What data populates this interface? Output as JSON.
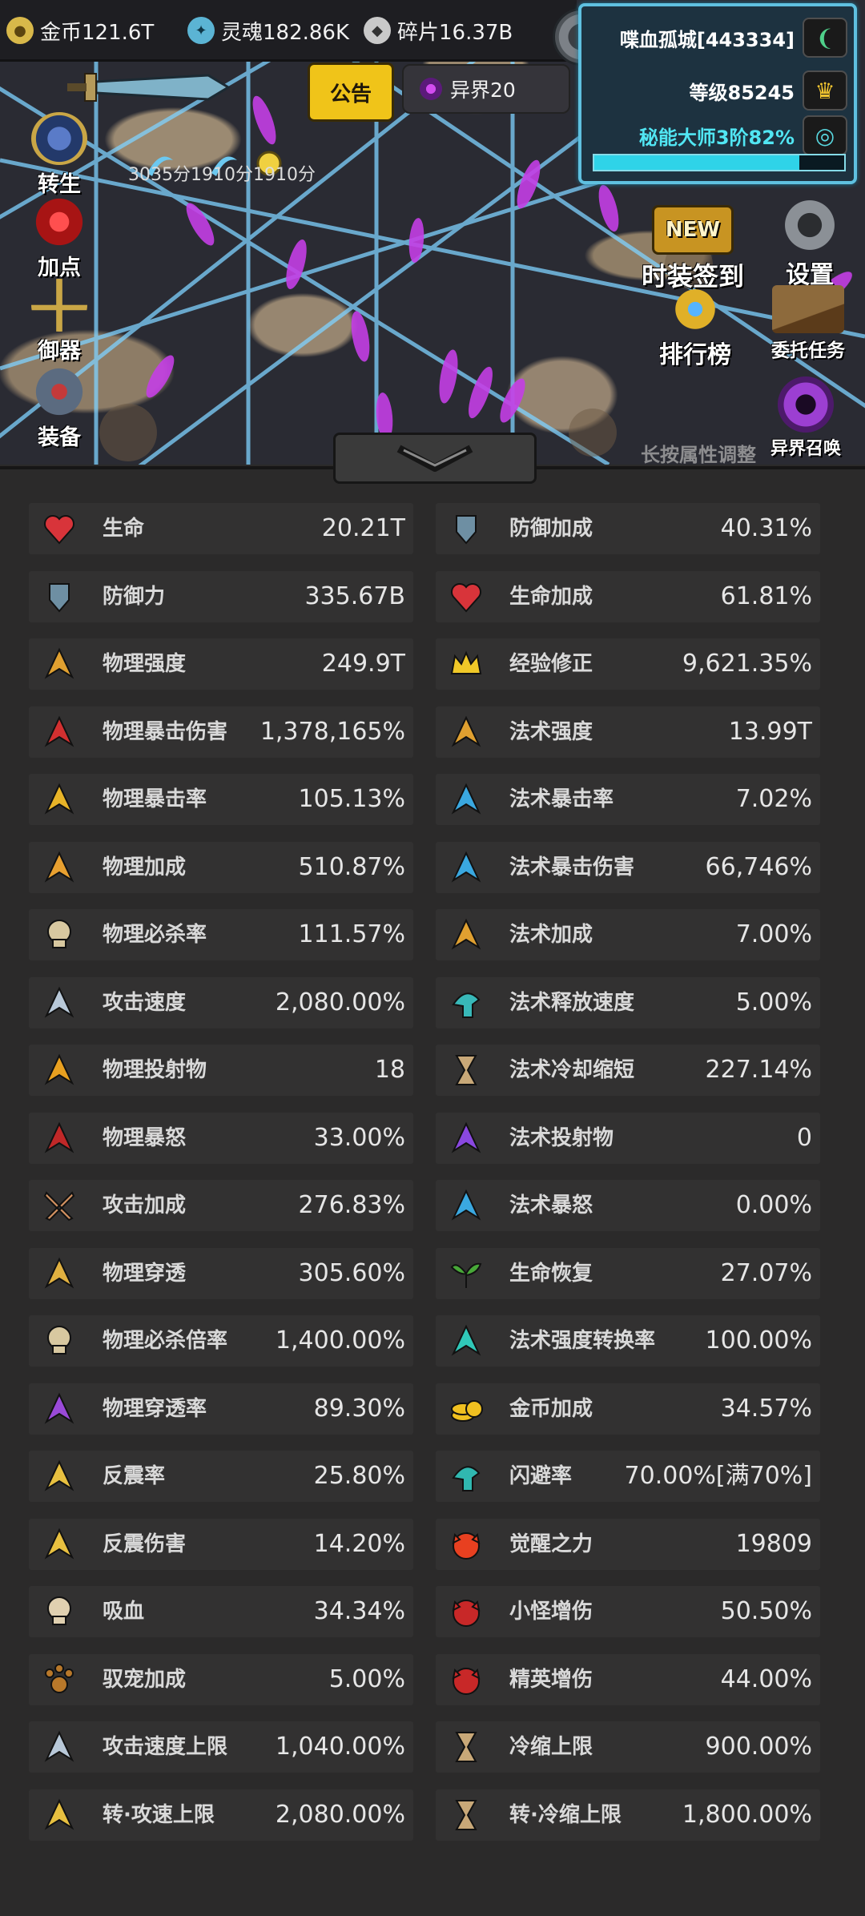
{
  "resources": [
    {
      "icon": "gold-coin-icon",
      "label": "金币121.6T"
    },
    {
      "icon": "soul-icon",
      "label": "灵魂182.86K"
    },
    {
      "icon": "shard-icon",
      "label": "碎片16.37B"
    }
  ],
  "player": {
    "name": "喋血孤城[443334]",
    "level": "等级85245",
    "rank": "秘能大师3阶82%",
    "rank_progress": 0.82
  },
  "top_buttons": {
    "notice": "公告",
    "realm": "异界20"
  },
  "buffs_text": "3035分1910分1910分",
  "left_menu": [
    "转生",
    "加点",
    "御器",
    "装备"
  ],
  "right_menu": {
    "new_badge": "NEW",
    "costume_signin": "时装签到",
    "settings": "设置",
    "ranking": "排行榜",
    "commission": "委托任务",
    "realm_summon": "异界召唤"
  },
  "hint": "长按属性调整",
  "stats_left": [
    {
      "label": "生命",
      "value": "20.21T",
      "icon": "heart-icon",
      "color": "#d8343a"
    },
    {
      "label": "防御力",
      "value": "335.67B",
      "icon": "shield-icon",
      "color": "#6e8fa3"
    },
    {
      "label": "物理强度",
      "value": "249.9T",
      "icon": "arrow-burst-icon",
      "color": "#e0a030"
    },
    {
      "label": "物理暴击伤害",
      "value": "1,378,165%",
      "icon": "crit-damage-icon",
      "color": "#d23030"
    },
    {
      "label": "物理暴击率",
      "value": "105.13%",
      "icon": "crit-rate-icon",
      "color": "#e8b428"
    },
    {
      "label": "物理加成",
      "value": "510.87%",
      "icon": "sword-bonus-icon",
      "color": "#e8a030"
    },
    {
      "label": "物理必杀率",
      "value": "111.57%",
      "icon": "skull-icon",
      "color": "#d8c8a0"
    },
    {
      "label": "攻击速度",
      "value": "2,080.00%",
      "icon": "attack-speed-icon",
      "color": "#b8c8d8"
    },
    {
      "label": "物理投射物",
      "value": "18",
      "icon": "projectile-icon",
      "color": "#e8a020"
    },
    {
      "label": "物理暴怒",
      "value": "33.00%",
      "icon": "rage-icon",
      "color": "#c02828"
    },
    {
      "label": "攻击加成",
      "value": "276.83%",
      "icon": "crossed-swords-icon",
      "color": "#d09060"
    },
    {
      "label": "物理穿透",
      "value": "305.60%",
      "icon": "penetration-icon",
      "color": "#e0b040"
    },
    {
      "label": "物理必杀倍率",
      "value": "1,400.00%",
      "icon": "skull-multiplier-icon",
      "color": "#d8c8a0"
    },
    {
      "label": "物理穿透率",
      "value": "89.30%",
      "icon": "penetration-rate-icon",
      "color": "#9a4ad8"
    },
    {
      "label": "反震率",
      "value": "25.80%",
      "icon": "reflect-icon",
      "color": "#e8c040"
    },
    {
      "label": "反震伤害",
      "value": "14.20%",
      "icon": "reflect-damage-icon",
      "color": "#e8c040"
    },
    {
      "label": "吸血",
      "value": "34.34%",
      "icon": "vampire-skull-icon",
      "color": "#e0d0b0"
    },
    {
      "label": "驭宠加成",
      "value": "5.00%",
      "icon": "paw-icon",
      "color": "#b8782a"
    },
    {
      "label": "攻击速度上限",
      "value": "1,040.00%",
      "icon": "attack-speed-cap-icon",
      "color": "#b8c8d8"
    },
    {
      "label": "转·攻速上限",
      "value": "2,080.00%",
      "icon": "attack-speed-cap-plus-icon",
      "color": "#e8c040"
    }
  ],
  "stats_right": [
    {
      "label": "防御加成",
      "value": "40.31%",
      "icon": "shield-plus-icon",
      "color": "#6e8fa3"
    },
    {
      "label": "生命加成",
      "value": "61.81%",
      "icon": "heart-plus-icon",
      "color": "#d8343a"
    },
    {
      "label": "经验修正",
      "value": "9,621.35%",
      "icon": "crown-icon",
      "color": "#f0c828"
    },
    {
      "label": "法术强度",
      "value": "13.99T",
      "icon": "magic-power-icon",
      "color": "#e0a030"
    },
    {
      "label": "法术暴击率",
      "value": "7.02%",
      "icon": "magic-crit-rate-icon",
      "color": "#3aa8e0"
    },
    {
      "label": "法术暴击伤害",
      "value": "66,746%",
      "icon": "magic-crit-damage-icon",
      "color": "#3aa8e0"
    },
    {
      "label": "法术加成",
      "value": "7.00%",
      "icon": "magic-bonus-icon",
      "color": "#e0a030"
    },
    {
      "label": "法术释放速度",
      "value": "5.00%",
      "icon": "cast-speed-icon",
      "color": "#38b8b8"
    },
    {
      "label": "法术冷却缩短",
      "value": "227.14%",
      "icon": "hourglass-icon",
      "color": "#c8a878"
    },
    {
      "label": "法术投射物",
      "value": "0",
      "icon": "magic-projectile-icon",
      "color": "#8a48e0"
    },
    {
      "label": "法术暴怒",
      "value": "0.00%",
      "icon": "magic-rage-icon",
      "color": "#3aa8e0"
    },
    {
      "label": "生命恢复",
      "value": "27.07%",
      "icon": "sprout-icon",
      "color": "#48a838"
    },
    {
      "label": "法术强度转换率",
      "value": "100.00%",
      "icon": "conversion-icon",
      "color": "#30c8b8"
    },
    {
      "label": "金币加成",
      "value": "34.57%",
      "icon": "coin-stack-icon",
      "color": "#f0c020"
    },
    {
      "label": "闪避率",
      "value": "70.00%[满70%]",
      "icon": "dodge-icon",
      "color": "#30b8b0"
    },
    {
      "label": "觉醒之力",
      "value": "19809",
      "icon": "awaken-icon",
      "color": "#e84020"
    },
    {
      "label": "小怪增伤",
      "value": "50.50%",
      "icon": "monster-icon",
      "color": "#c82828"
    },
    {
      "label": "精英增伤",
      "value": "44.00%",
      "icon": "elite-icon",
      "color": "#c82828"
    },
    {
      "label": "冷缩上限",
      "value": "900.00%",
      "icon": "cooldown-cap-icon",
      "color": "#c8a878"
    },
    {
      "label": "转·冷缩上限",
      "value": "1,800.00%",
      "icon": "cooldown-cap-plus-icon",
      "color": "#c8a878"
    }
  ]
}
